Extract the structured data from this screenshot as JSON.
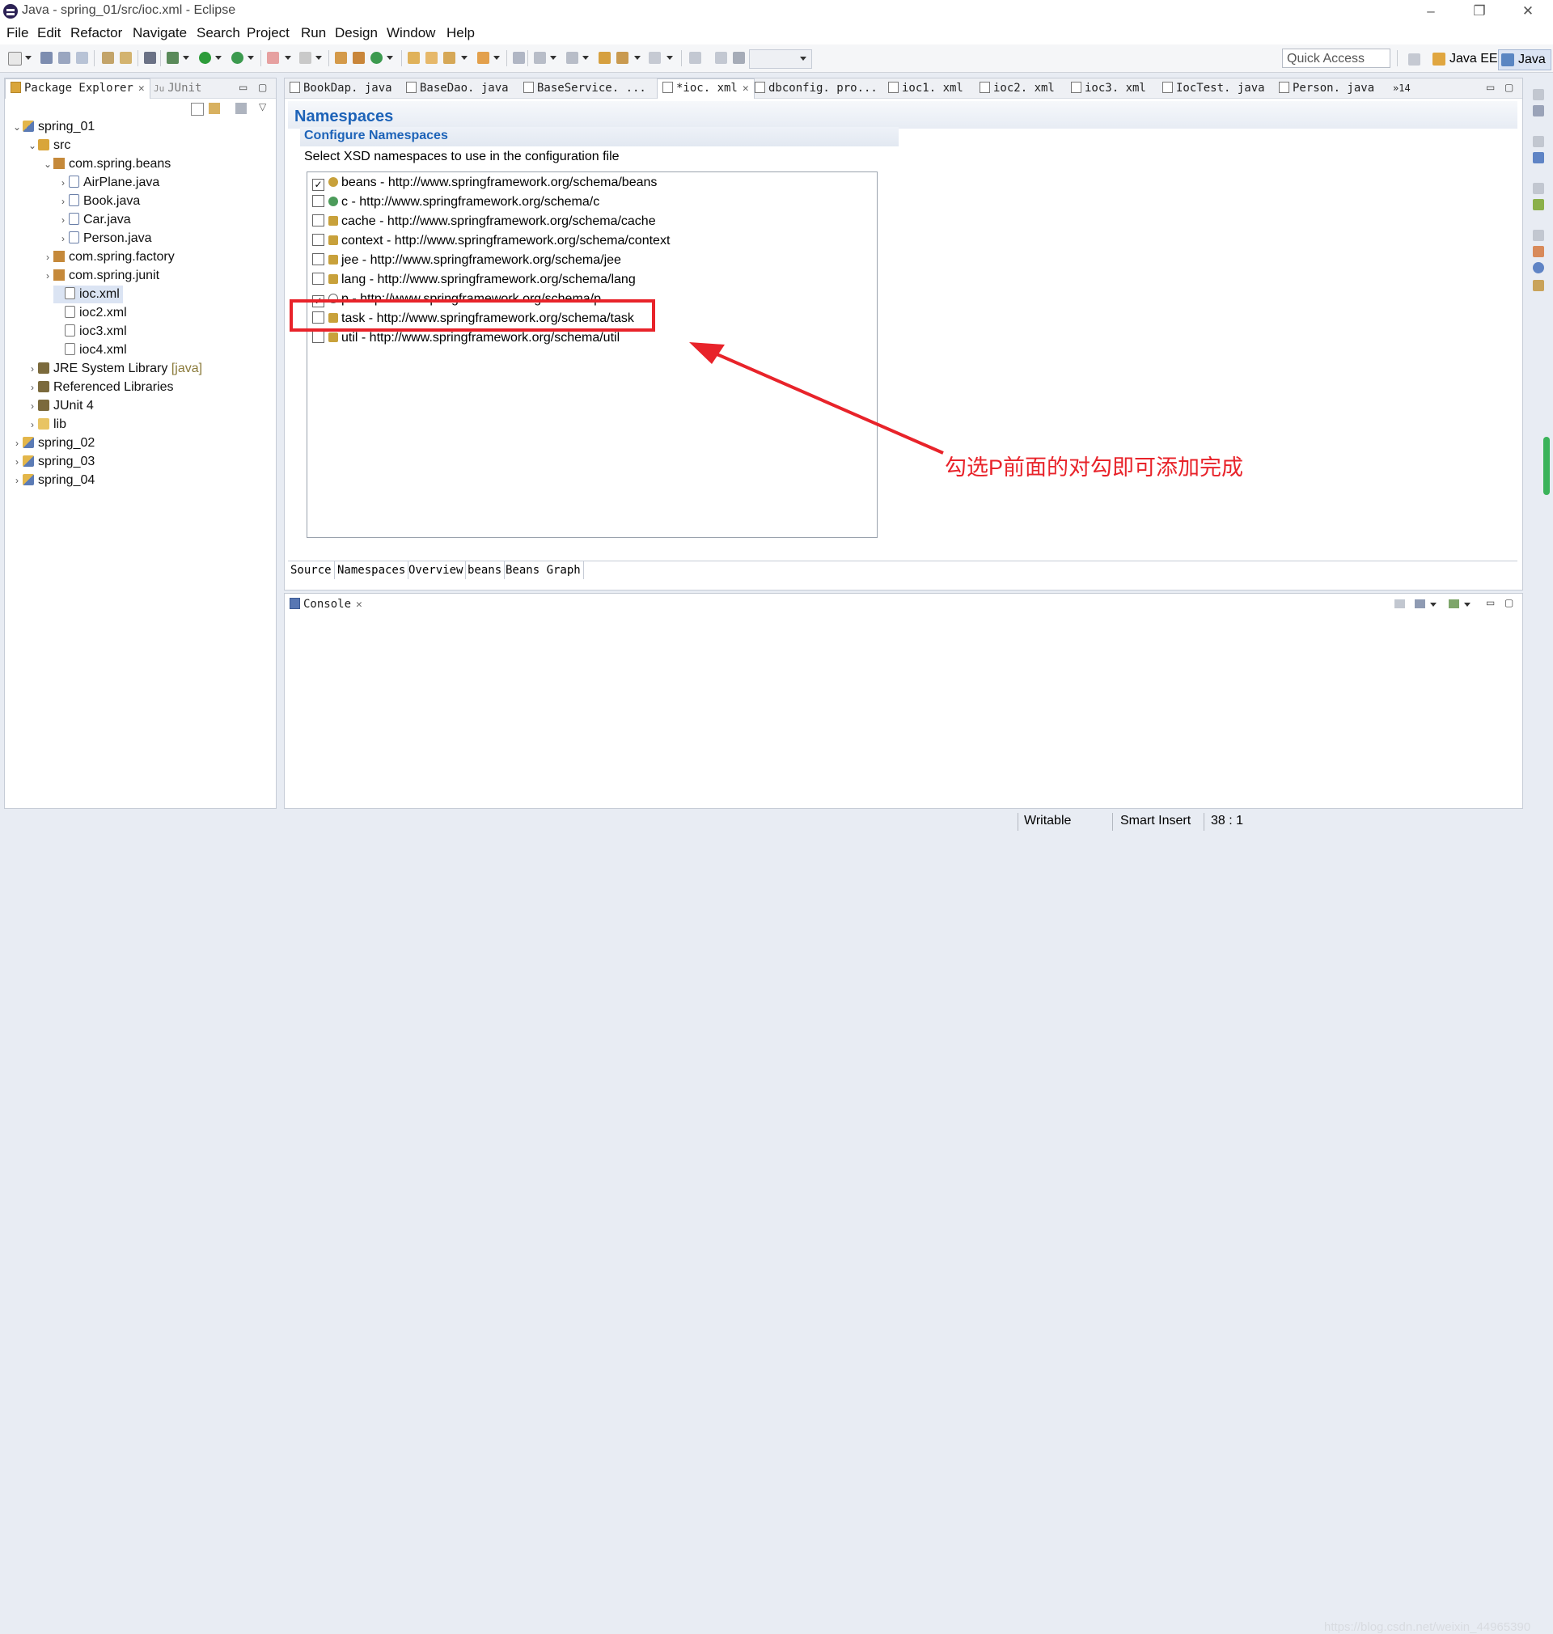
{
  "window": {
    "title": "Java - spring_01/src/ioc.xml - Eclipse",
    "minimize": "–",
    "restore": "❐",
    "close": "✕"
  },
  "menu": [
    "File",
    "Edit",
    "Refactor",
    "Navigate",
    "Search",
    "Project",
    "Run",
    "Design",
    "Window",
    "Help"
  ],
  "toolbar": {
    "quick_access_placeholder": "Quick Access",
    "perspectives": [
      "Java EE",
      "Java"
    ]
  },
  "explorer": {
    "tabs": [
      {
        "label": "Package Explorer"
      },
      {
        "label": "JUnit"
      }
    ],
    "tree": [
      {
        "label": "spring_01",
        "icon": "project-icon",
        "expanded": true
      },
      {
        "label": "src",
        "icon": "source-folder-icon",
        "expanded": true
      },
      {
        "label": "com.spring.beans",
        "icon": "package-icon",
        "expanded": true
      },
      {
        "label": "AirPlane.java",
        "icon": "java-file-icon"
      },
      {
        "label": "Book.java",
        "icon": "java-file-icon"
      },
      {
        "label": "Car.java",
        "icon": "java-file-icon"
      },
      {
        "label": "Person.java",
        "icon": "java-file-icon"
      },
      {
        "label": "com.spring.factory",
        "icon": "package-icon"
      },
      {
        "label": "com.spring.junit",
        "icon": "package-icon"
      },
      {
        "label": "ioc.xml",
        "icon": "xml-file-icon",
        "selected": true
      },
      {
        "label": "ioc2.xml",
        "icon": "xml-file-icon"
      },
      {
        "label": "ioc3.xml",
        "icon": "xml-file-icon"
      },
      {
        "label": "ioc4.xml",
        "icon": "xml-file-icon"
      },
      {
        "label": "JRE System Library",
        "suffix": "[java]",
        "icon": "library-icon"
      },
      {
        "label": "Referenced Libraries",
        "icon": "library-icon"
      },
      {
        "label": "JUnit 4",
        "icon": "library-icon"
      },
      {
        "label": "lib",
        "icon": "folder-icon"
      },
      {
        "label": "spring_02",
        "icon": "project-icon"
      },
      {
        "label": "spring_03",
        "icon": "project-icon"
      },
      {
        "label": "spring_04",
        "icon": "project-icon"
      }
    ]
  },
  "editor": {
    "tabs": [
      "BookDap. java",
      "BaseDao. java",
      "BaseService. ...",
      "*ioc. xml",
      "dbconfig. pro...",
      "ioc1. xml",
      "ioc2. xml",
      "ioc3. xml",
      "IocTest. java",
      "Person. java"
    ],
    "overflow": "»14",
    "section_title": "Namespaces",
    "configure_title": "Configure Namespaces",
    "configure_desc": "Select XSD namespaces to use in the configuration file",
    "namespaces": [
      {
        "label": "beans - http://www.springframework.org/schema/beans",
        "checked": true,
        "color": "#c8a13b"
      },
      {
        "label": "c - http://www.springframework.org/schema/c",
        "checked": false,
        "color": "#4c9b5a"
      },
      {
        "label": "cache - http://www.springframework.org/schema/cache",
        "checked": false,
        "color": "#c8a13b"
      },
      {
        "label": "context - http://www.springframework.org/schema/context",
        "checked": false,
        "color": "#c8a13b"
      },
      {
        "label": "jee - http://www.springframework.org/schema/jee",
        "checked": false,
        "color": "#c8a13b"
      },
      {
        "label": "lang - http://www.springframework.org/schema/lang",
        "checked": false,
        "color": "#c8a13b"
      },
      {
        "label": "p - http://www.springframework.org/schema/p",
        "checked": true,
        "color": "#7a7a7a"
      },
      {
        "label": "task - http://www.springframework.org/schema/task",
        "checked": false,
        "color": "#c8a13b"
      },
      {
        "label": "util - http://www.springframework.org/schema/util",
        "checked": false,
        "color": "#c8a13b"
      }
    ],
    "bottom_tabs": [
      "Source",
      "Namespaces",
      "Overview",
      "beans",
      "Beans Graph"
    ],
    "annotation": "勾选P前面的对勾即可添加完成",
    "annotation_color": "#e8232a"
  },
  "console": {
    "tab_label": "Console"
  },
  "status": {
    "writable": "Writable",
    "insert_mode": "Smart Insert",
    "position": "38 : 1",
    "watermark": "https://blog.csdn.net/weixin_44965390"
  }
}
